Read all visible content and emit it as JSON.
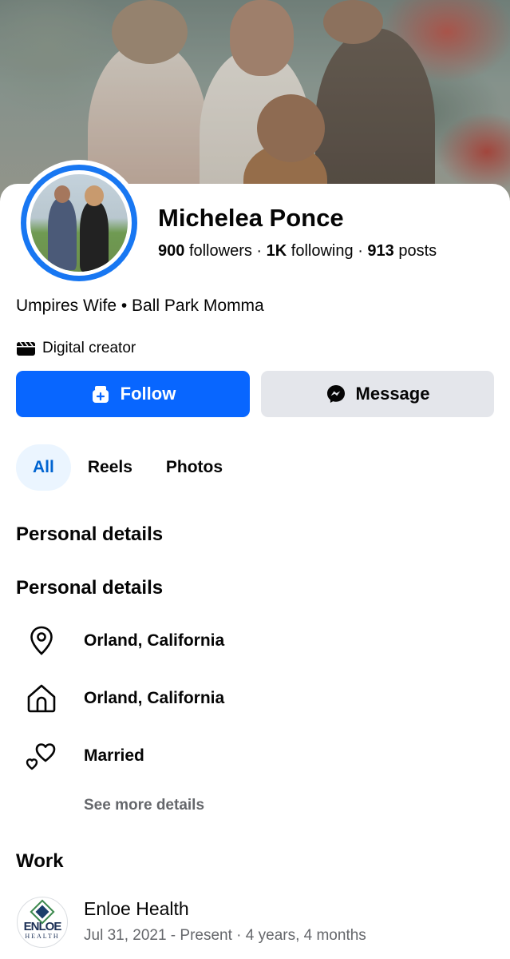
{
  "profile": {
    "name": "Michelea Ponce",
    "followers_count": "900",
    "followers_label": "followers",
    "following_count": "1K",
    "following_label": "following",
    "posts_count": "913",
    "posts_label": "posts",
    "separator": "·",
    "bio": "Umpires Wife • Ball Park Momma",
    "category": "Digital creator"
  },
  "actions": {
    "follow_label": "Follow",
    "message_label": "Message"
  },
  "tabs": [
    {
      "label": "All",
      "active": true
    },
    {
      "label": "Reels",
      "active": false
    },
    {
      "label": "Photos",
      "active": false
    }
  ],
  "sections": {
    "personal_details_1": "Personal details",
    "personal_details_2": "Personal details",
    "work": "Work"
  },
  "details": [
    {
      "icon": "location-pin-icon",
      "text": "Orland, California"
    },
    {
      "icon": "home-icon",
      "text": "Orland, California"
    },
    {
      "icon": "hearts-icon",
      "text": "Married"
    }
  ],
  "see_more": "See more details",
  "work": {
    "logo_text_1": "ENLOE",
    "logo_text_2": "HEALTH",
    "employer": "Enloe Health",
    "period": "Jul 31, 2021 - Present · 4 years, 4 months"
  },
  "colors": {
    "accent": "#0866ff",
    "ring": "#1877f2",
    "secondary_button": "#e4e6eb",
    "active_tab_bg": "#ebf5ff",
    "active_tab_text": "#0064d1",
    "muted_text": "#65676b"
  }
}
